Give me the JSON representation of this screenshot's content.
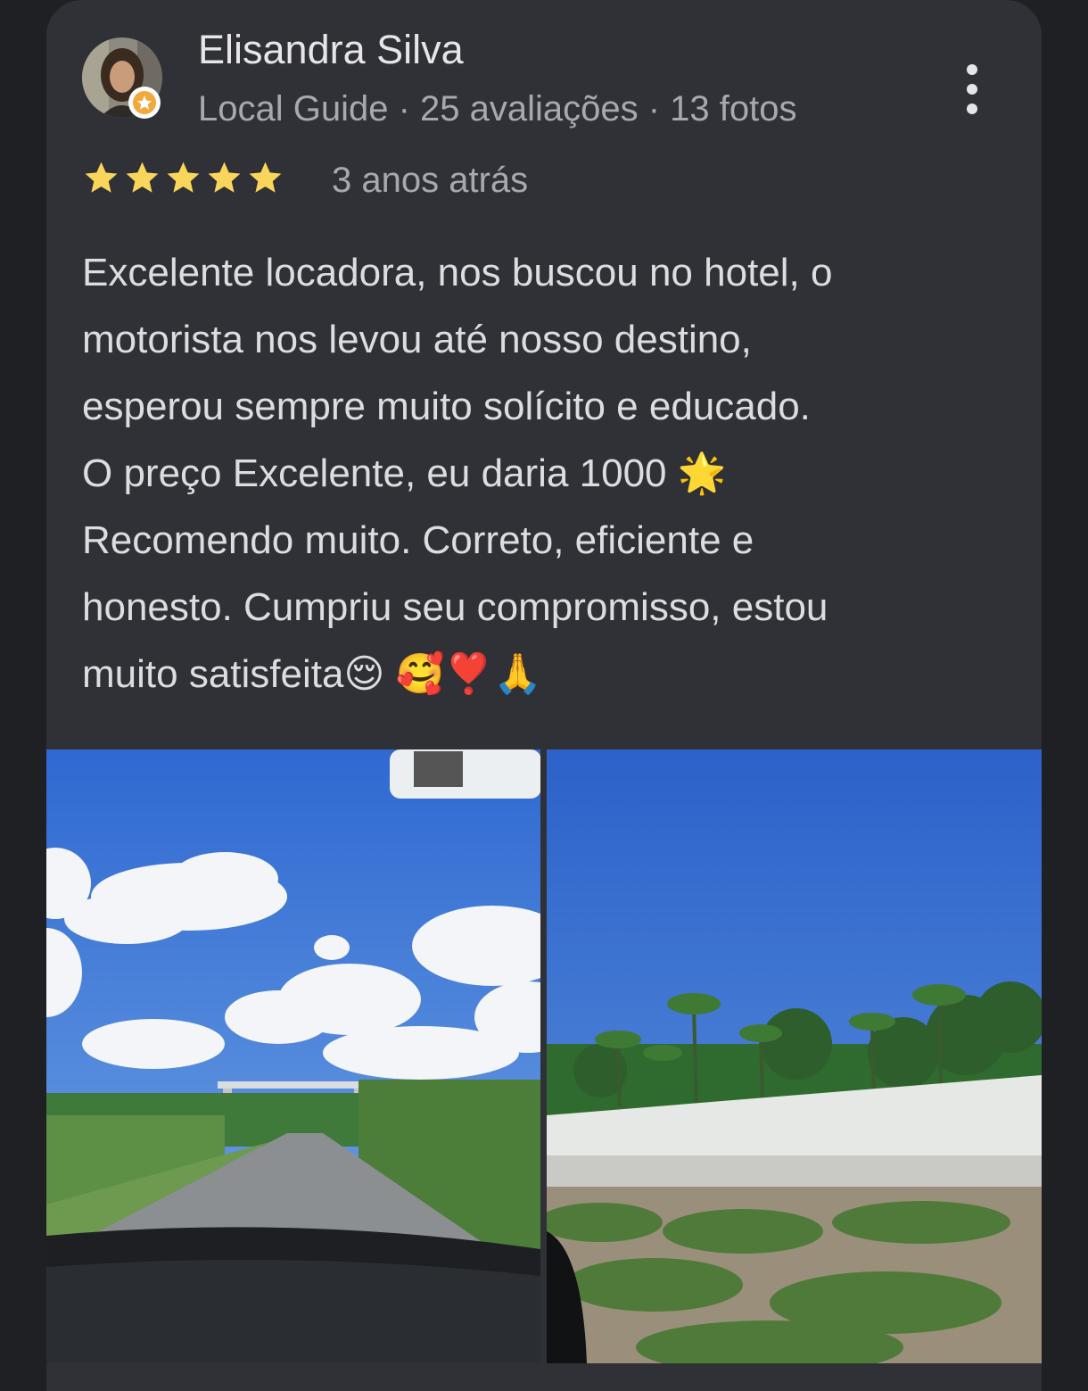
{
  "reviewer": {
    "name": "Elisandra Silva",
    "meta": "Local Guide · 25 avaliações · 13 fotos"
  },
  "review": {
    "rating": 5,
    "rating_max": 5,
    "time": "3 anos atrás",
    "lines": [
      "Excelente locadora, nos buscou no hotel, o",
      "motorista nos levou até nosso destino,",
      "esperou sempre muito solícito e educado.",
      "O preço Excelente, eu daria 1000 🌟",
      "Recomendo muito. Correto, eficiente e",
      "honesto. Cumpriu seu compromisso, estou",
      "muito satisfeita😌 🥰❣️🙏"
    ]
  },
  "icons": {
    "menu": "more-vert-icon",
    "star": "star-icon",
    "badge": "local-guide-badge-icon"
  },
  "colors": {
    "card": "#303136",
    "background": "#1f2024",
    "star": "#f9d65b",
    "name": "#e6e6ea",
    "meta": "#a8a9ae",
    "text": "#dcdde1"
  }
}
